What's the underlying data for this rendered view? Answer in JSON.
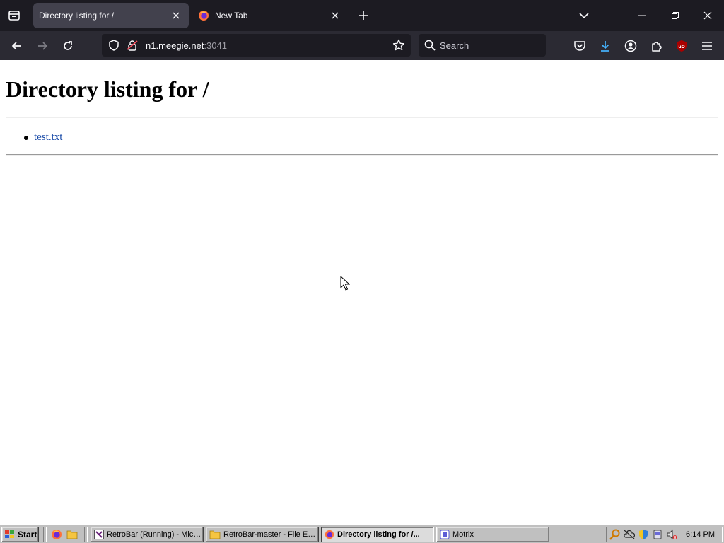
{
  "browser": {
    "tabs": [
      {
        "title": "Directory listing for /",
        "active": true
      },
      {
        "title": "New Tab",
        "active": false
      }
    ],
    "url": {
      "host_bright": "n1.meegie.net",
      "port_dim": ":3041"
    },
    "search_placeholder": "Search"
  },
  "page": {
    "heading": "Directory listing for /",
    "files": [
      "test.txt"
    ]
  },
  "taskbar": {
    "start_label": "Start",
    "tasks": [
      {
        "label": "RetroBar (Running) - Micro..."
      },
      {
        "label": "RetroBar-master - File Expl..."
      },
      {
        "label": "Directory listing for /..."
      },
      {
        "label": "Motrix"
      }
    ],
    "clock": "6:14 PM"
  },
  "colors": {
    "tab_strip": "#1c1b22",
    "nav_bar": "#2b2a33",
    "active_tab": "#42414d",
    "taskbar": "#c0c0c0",
    "link": "#1a4ba8",
    "download_accent": "#45b3ff",
    "ublock_red": "#a00"
  }
}
